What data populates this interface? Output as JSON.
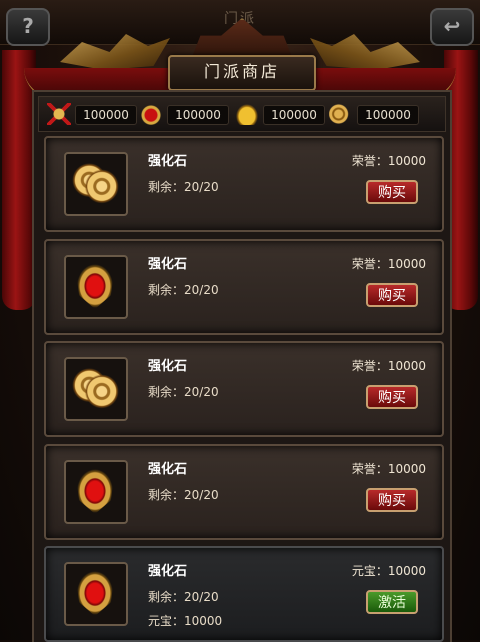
{
  "header": {
    "top_label": "门派",
    "help_glyph": "?",
    "back_glyph": "↩",
    "shop_title": "门派商店"
  },
  "currencies": [
    {
      "icon": "crossed-axes-icon",
      "value": "100000"
    },
    {
      "icon": "shield-emblem-icon",
      "value": "100000"
    },
    {
      "icon": "gold-ingot-icon",
      "value": "100000"
    },
    {
      "icon": "coin-stack-icon",
      "value": "100000"
    }
  ],
  "items": [
    {
      "name": "强化石",
      "stock": "剩余：20/20",
      "price": "荣誉：10000",
      "button": "购买",
      "icon": "coins-icon",
      "extra": ""
    },
    {
      "name": "强化石",
      "stock": "剩余：20/20",
      "price": "荣誉：10000",
      "button": "购买",
      "icon": "red-gem-shield-icon",
      "extra": ""
    },
    {
      "name": "强化石",
      "stock": "剩余：20/20",
      "price": "荣誉：10000",
      "button": "购买",
      "icon": "coins-icon",
      "extra": ""
    },
    {
      "name": "强化石",
      "stock": "剩余：20/20",
      "price": "荣誉：10000",
      "button": "购买",
      "icon": "red-gem-shield-icon",
      "extra": ""
    },
    {
      "name": "强化石",
      "stock": "剩余：20/20",
      "price": "元宝：10000",
      "button": "激活",
      "icon": "red-gem-shield-icon",
      "extra": "元宝：10000"
    }
  ],
  "colors": {
    "buy_button": "#9a1a1a",
    "activate_button": "#3a7a1a",
    "frame_gold": "#c8a070"
  }
}
